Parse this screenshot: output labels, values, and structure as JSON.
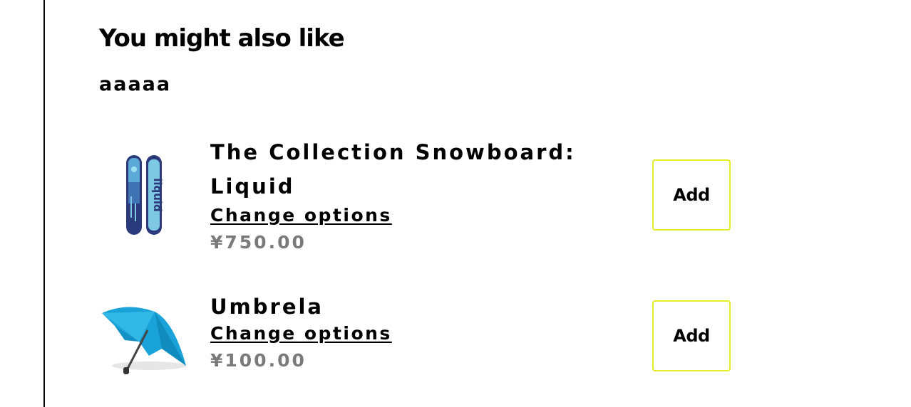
{
  "section": {
    "heading": "You might also like",
    "subheading": "aaaaa"
  },
  "products": [
    {
      "title": "The Collection Snowboard: Liquid",
      "change_options_label": "Change options",
      "price": "¥750.00",
      "add_label": "Add",
      "image_icon": "snowboard-image"
    },
    {
      "title": "Umbrela",
      "change_options_label": "Change options",
      "price": "¥100.00",
      "add_label": "Add",
      "image_icon": "umbrella-image"
    }
  ],
  "colors": {
    "add_button_border": "#e2ec2b",
    "price_text": "#7a7a7a",
    "snowboard_dark": "#2b3a7a",
    "snowboard_light": "#7ec8e3",
    "umbrella_blue": "#1aa3d9"
  }
}
